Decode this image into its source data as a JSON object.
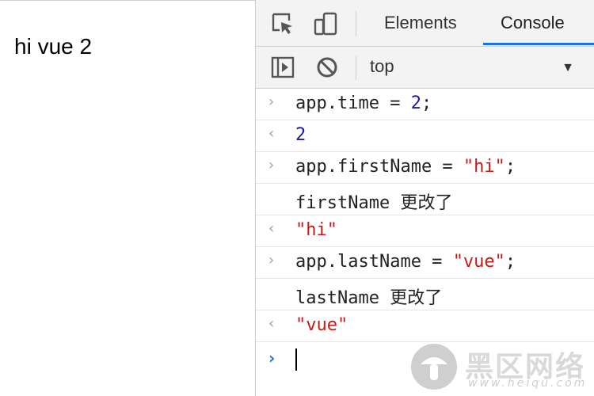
{
  "page": {
    "text": "hi vue 2"
  },
  "devtools": {
    "tabs": [
      {
        "label": "Elements",
        "active": false
      },
      {
        "label": "Console",
        "active": true
      }
    ],
    "toolbar": {
      "context": "top"
    },
    "console_rows": [
      {
        "type": "input",
        "code": [
          {
            "t": "app.time = ",
            "c": "plain"
          },
          {
            "t": "2",
            "c": "num"
          },
          {
            "t": ";",
            "c": "plain"
          }
        ]
      },
      {
        "type": "output",
        "code": [
          {
            "t": "2",
            "c": "num"
          }
        ]
      },
      {
        "type": "input",
        "code": [
          {
            "t": "app.firstName = ",
            "c": "plain"
          },
          {
            "t": "\"hi\"",
            "c": "str"
          },
          {
            "t": ";",
            "c": "plain"
          }
        ]
      },
      {
        "type": "log",
        "code": [
          {
            "t": "firstName 更改了",
            "c": "plain"
          }
        ]
      },
      {
        "type": "output",
        "code": [
          {
            "t": "\"hi\"",
            "c": "str"
          }
        ]
      },
      {
        "type": "input",
        "code": [
          {
            "t": "app.lastName = ",
            "c": "plain"
          },
          {
            "t": "\"vue\"",
            "c": "str"
          },
          {
            "t": ";",
            "c": "plain"
          }
        ]
      },
      {
        "type": "log",
        "code": [
          {
            "t": "lastName 更改了",
            "c": "plain"
          }
        ]
      },
      {
        "type": "output",
        "code": [
          {
            "t": "\"vue\"",
            "c": "str"
          }
        ]
      }
    ]
  },
  "watermark": {
    "title": "黑区网络",
    "url": "www.heiqu.com"
  },
  "colors": {
    "accent": "#1a73e8",
    "string": "#c41a16",
    "number": "#1a1aa6"
  }
}
